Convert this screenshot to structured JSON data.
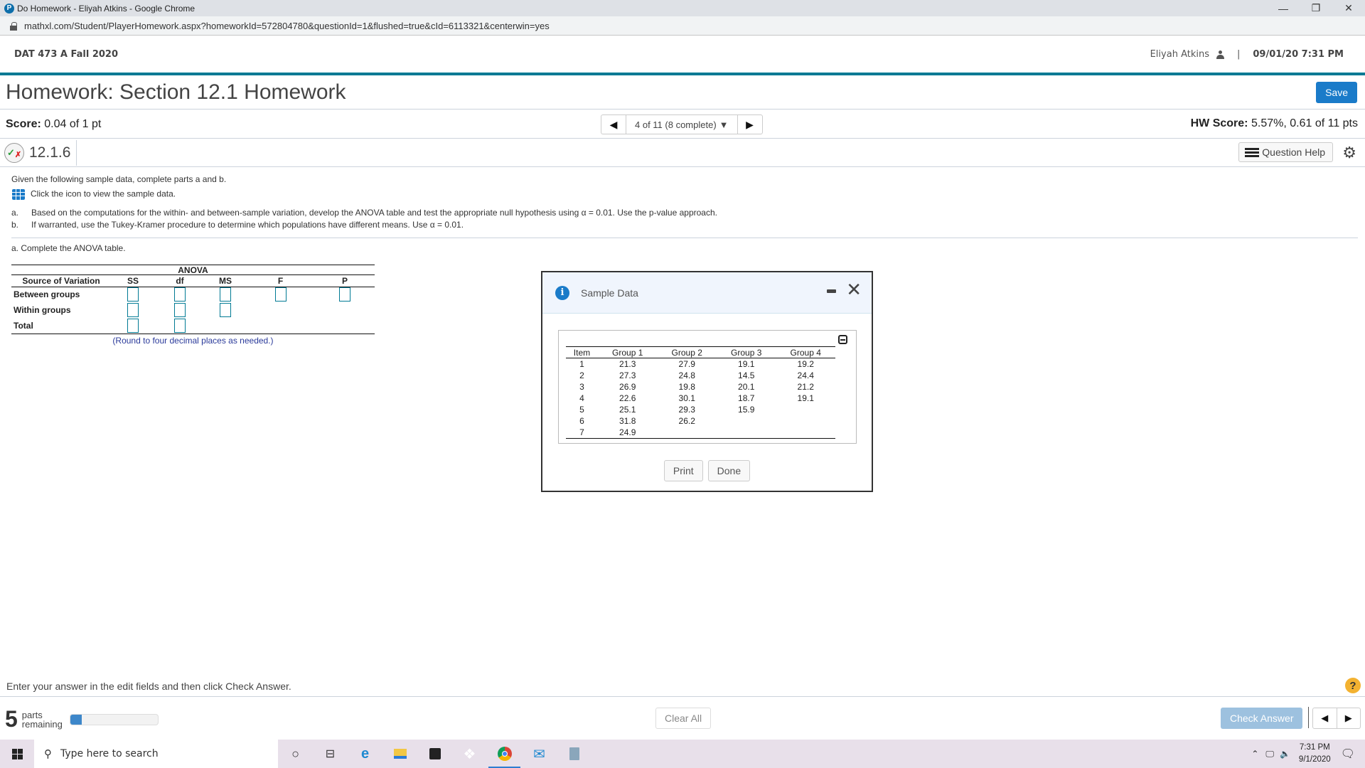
{
  "browser": {
    "window_title": "Do Homework - Eliyah Atkins - Google Chrome",
    "url": "mathxl.com/Student/PlayerHomework.aspx?homeworkId=572804780&questionId=1&flushed=true&cId=6113321&centerwin=yes",
    "controls": {
      "minimize": "—",
      "restore": "❐",
      "close": "✕"
    }
  },
  "header": {
    "course": "DAT 473 A Fall 2020",
    "user": "Eliyah Atkins",
    "separator": "|",
    "datetime": "09/01/20 7:31 PM",
    "accent_color": "#007a94"
  },
  "homework": {
    "title": "Homework: Section 12.1 Homework",
    "save_label": "Save",
    "score_label": "Score:",
    "score_value": "0.04 of 1 pt",
    "question_nav": "4 of 11 (8 complete)",
    "hw_score_label": "HW Score:",
    "hw_score_value": "5.57%, 0.61 of 11 pts",
    "question_id": "12.1.6",
    "question_help": "Question Help"
  },
  "question": {
    "intro": "Given the following sample data, complete parts a and b.",
    "data_link": "Click the icon to view the sample data.",
    "parts": [
      {
        "marker": "a.",
        "text": "Based on the computations for the within- and between-sample variation, develop the ANOVA table and test the appropriate null hypothesis using α = 0.01. Use the p-value approach."
      },
      {
        "marker": "b.",
        "text": "If warranted, use the Tukey-Kramer procedure to determine which populations have different means. Use α = 0.01."
      }
    ],
    "part_a_prompt": "a. Complete the ANOVA table."
  },
  "anova": {
    "title": "ANOVA",
    "columns": [
      "Source of Variation",
      "SS",
      "df",
      "MS",
      "F",
      "P"
    ],
    "rows": [
      {
        "label": "Between groups",
        "ss": "",
        "df": "",
        "ms": "",
        "f": "",
        "p": ""
      },
      {
        "label": "Within groups",
        "ss": "",
        "df": "",
        "ms": ""
      },
      {
        "label": "Total",
        "ss": "",
        "df": ""
      }
    ],
    "note": "(Round to four decimal places as needed.)"
  },
  "modal": {
    "title": "Sample Data",
    "columns": [
      "Item",
      "Group 1",
      "Group 2",
      "Group 3",
      "Group 4"
    ],
    "rows": [
      [
        "1",
        "21.3",
        "27.9",
        "19.1",
        "19.2"
      ],
      [
        "2",
        "27.3",
        "24.8",
        "14.5",
        "24.4"
      ],
      [
        "3",
        "26.9",
        "19.8",
        "20.1",
        "21.2"
      ],
      [
        "4",
        "22.6",
        "30.1",
        "18.7",
        "19.1"
      ],
      [
        "5",
        "25.1",
        "29.3",
        "15.9",
        ""
      ],
      [
        "6",
        "31.8",
        "26.2",
        "",
        ""
      ],
      [
        "7",
        "24.9",
        "",
        "",
        ""
      ]
    ],
    "print_label": "Print",
    "done_label": "Done"
  },
  "footer": {
    "instruction": "Enter your answer in the edit fields and then click Check Answer.",
    "parts_remaining": "5",
    "parts_label_1": "parts",
    "parts_label_2": "remaining",
    "progress_fraction": 0.13,
    "clear_all": "Clear All",
    "check_answer": "Check Answer",
    "help": "?"
  },
  "taskbar": {
    "search_placeholder": "Type here to search",
    "time": "7:31 PM",
    "date": "9/1/2020"
  }
}
